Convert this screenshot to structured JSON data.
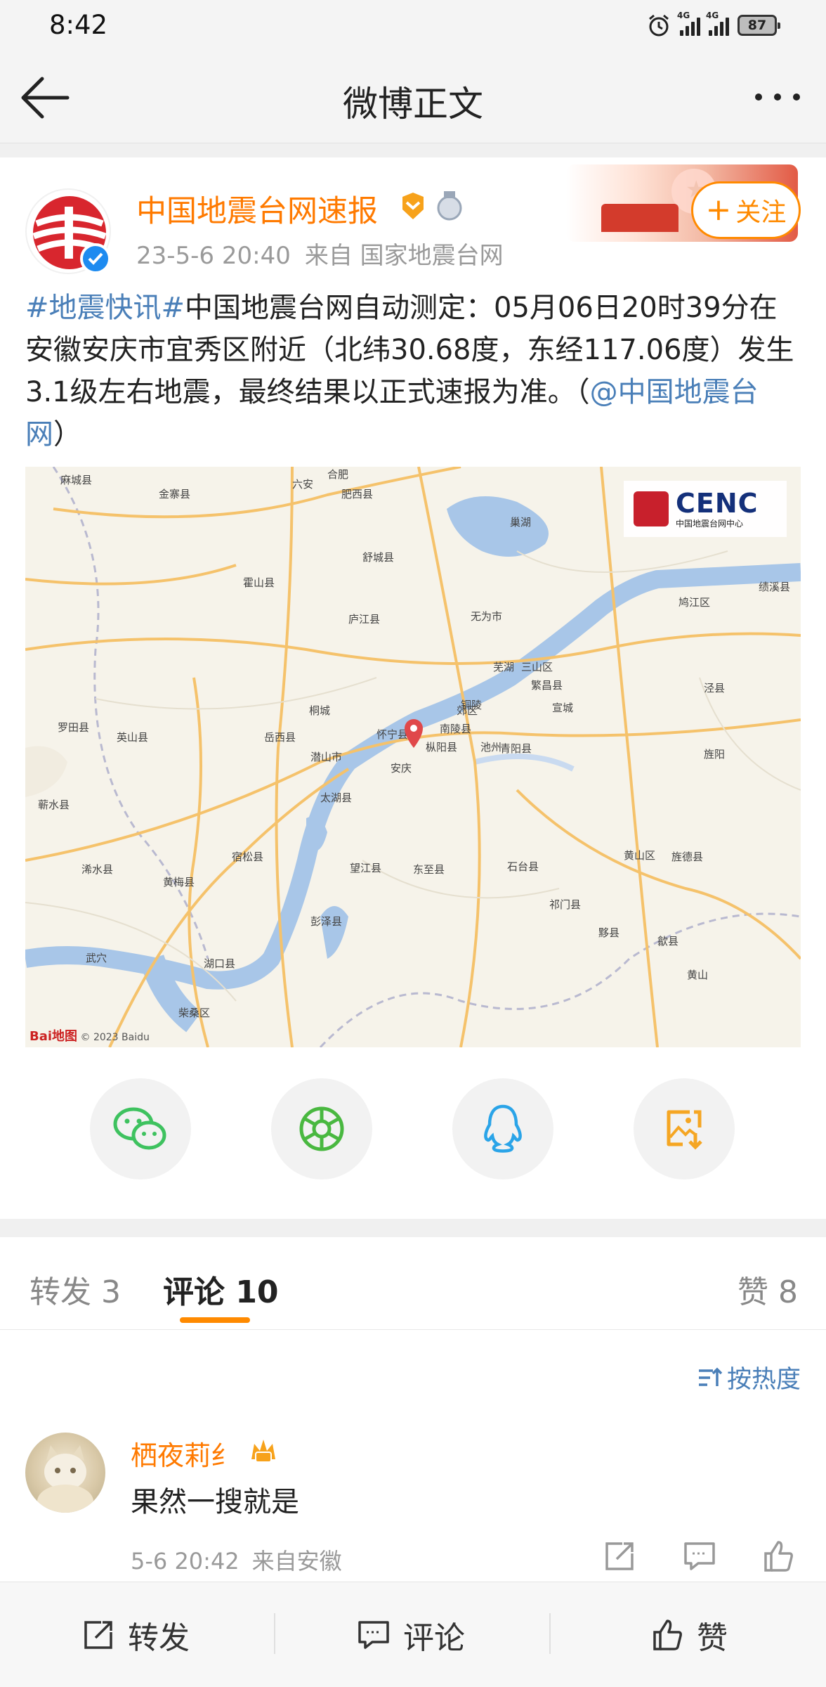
{
  "status_bar": {
    "time": "8:42",
    "network_1": "4G",
    "network_2": "4G",
    "battery": "87"
  },
  "nav": {
    "title": "微博正文",
    "back_icon": "arrow-left-icon",
    "more_icon": "more-dots-icon"
  },
  "post": {
    "author": "中国地震台网速报",
    "time": "23-5-6 20:40",
    "source": "来自 国家地震台网",
    "follow_label": "关注",
    "text": {
      "hashtag": "#地震快讯#",
      "body": "中国地震台网自动测定：05月06日20时39分在安徽安庆市宜秀区附近（北纬30.68度，东经117.06度）发生3.1级左右地震，最终结果以正式速报为准。（",
      "mention": "@中国地震台网",
      "tail": "）"
    },
    "map": {
      "logo_text": "CENC",
      "logo_subtext": "中国地震台网中心",
      "attribution_brand": "Bai地图",
      "attribution": "© 2023 Baidu",
      "places": [
        "合肥",
        "麻城县",
        "金寨县",
        "六安",
        "肥西县",
        "舒城县",
        "霍山县",
        "巢湖",
        "庐江县",
        "无为市",
        "芜湖",
        "三山区",
        "繁昌县",
        "宣城",
        "罗田县",
        "英山县",
        "岳西县",
        "桐城",
        "怀宁县",
        "枞阳县",
        "池州",
        "安庆",
        "潜山市",
        "太湖县",
        "铜陵",
        "南陵县",
        "郊区",
        "青阳县",
        "蕲水县",
        "宿松县",
        "望江县",
        "东至县",
        "石台县",
        "黄山区",
        "旌德县",
        "黄梅县",
        "彭泽县",
        "祁门县",
        "黟县",
        "歙县",
        "湖口县",
        "柴桑区",
        "武穴",
        "浠水县",
        "鸠江区",
        "泾县",
        "旌阳",
        "绩溪县",
        "黄山"
      ]
    },
    "share_icons": [
      "wechat-icon",
      "moments-icon",
      "qq-icon",
      "save-image-icon"
    ]
  },
  "tabs": {
    "repost": "转发 3",
    "comment": "评论 10",
    "like": "赞 8"
  },
  "sort_label": "按热度",
  "comment": {
    "user": "栖夜莉纟",
    "text": "果然一搜就是",
    "time": "5-6 20:42",
    "location": "来自安徽"
  },
  "bottom_bar": {
    "repost": "转发",
    "comment": "评论",
    "like": "赞"
  },
  "colors": {
    "accent": "#ff8a00",
    "author": "#ff7a00",
    "link": "#4a7fb8",
    "muted": "#9a9a9a"
  }
}
